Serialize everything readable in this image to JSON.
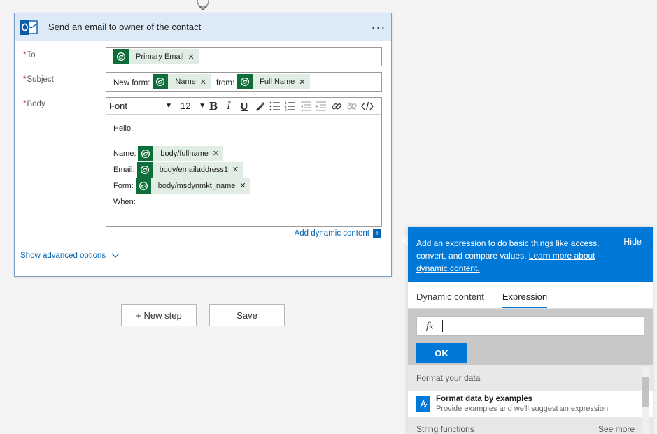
{
  "action": {
    "title": "Send an email to owner of the contact",
    "menu_label": "···"
  },
  "fields": {
    "to": {
      "label": "To",
      "tokens": [
        {
          "label": "Primary Email"
        }
      ]
    },
    "subject": {
      "label": "Subject",
      "text_before": "New form:",
      "token1": "Name",
      "text_middle": "from:",
      "token2": "Full Name"
    },
    "body": {
      "label": "Body",
      "font_select": "Font",
      "size_select": "12",
      "greeting": "Hello,",
      "lines": [
        {
          "label": "Name:",
          "token": "body/fullname"
        },
        {
          "label": "Email:",
          "token": "body/emailaddress1"
        },
        {
          "label": "Form:",
          "token": "body/msdynmkt_name"
        }
      ],
      "when_label": "When:"
    }
  },
  "add_dynamic_content": "Add dynamic content",
  "show_advanced": "Show advanced options",
  "buttons": {
    "new_step": "+ New step",
    "save": "Save"
  },
  "panel": {
    "intro": "Add an expression to do basic things like access, convert, and compare values.",
    "learn_more": "Learn more about dynamic content.",
    "hide": "Hide",
    "tabs": [
      "Dynamic content",
      "Expression"
    ],
    "active_tab": "Expression",
    "fx_symbol": "fx",
    "ok": "OK",
    "section1": "Format your data",
    "item_title": "Format data by examples",
    "item_desc": "Provide examples and we'll suggest an expression",
    "section2": "String functions",
    "see_more": "See more"
  },
  "colors": {
    "accent": "#0078d7",
    "link": "#0063b1",
    "dataverse_green": "#0d6e3a",
    "header_bg": "#dce9f7"
  }
}
